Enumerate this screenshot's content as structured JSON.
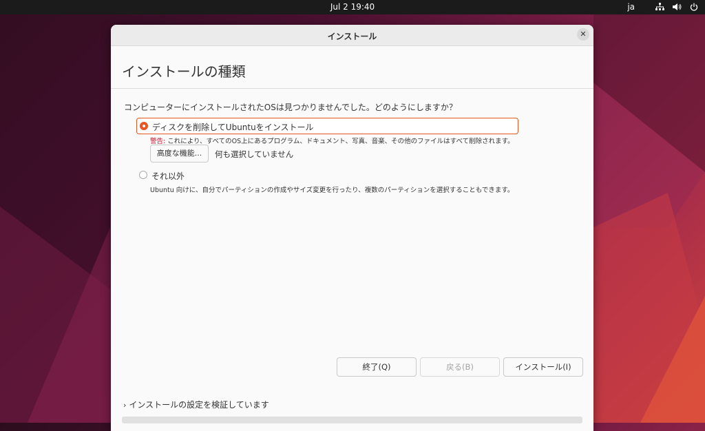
{
  "topbar": {
    "clock": "Jul 2  19:40",
    "language": "ja",
    "icons": [
      "network-icon",
      "volume-icon",
      "power-icon"
    ]
  },
  "window": {
    "title": "インストール",
    "close_symbol": "✕"
  },
  "page": {
    "heading": "インストールの種類",
    "question": "コンピューターにインストールされたOSは見つかりませんでした。どのようにしますか？"
  },
  "options": {
    "erase": {
      "label": "ディスクを削除してUbuntuをインストール",
      "selected": true,
      "warning_label": "警告:",
      "warning_text": " これにより、すべてのOS上にあるプログラム、ドキュメント、写真、音楽、その他のファイルはすべて削除されます。",
      "advanced_button": "高度な機能...",
      "advanced_status": "何も選択していません"
    },
    "other": {
      "label": "それ以外",
      "selected": false,
      "description": "Ubuntu 向けに、自分でパーティションの作成やサイズ変更を行ったり、複数のパーティションを選択することもできます。"
    }
  },
  "buttons": {
    "quit": "終了(Q)",
    "back": "戻る(B)",
    "install": "インストール(I)"
  },
  "footer": {
    "chevron": "›",
    "status": "インストールの設定を検証しています",
    "progress_fraction": 0
  },
  "colors": {
    "accent": "#e95420",
    "warning": "#c7162b"
  }
}
